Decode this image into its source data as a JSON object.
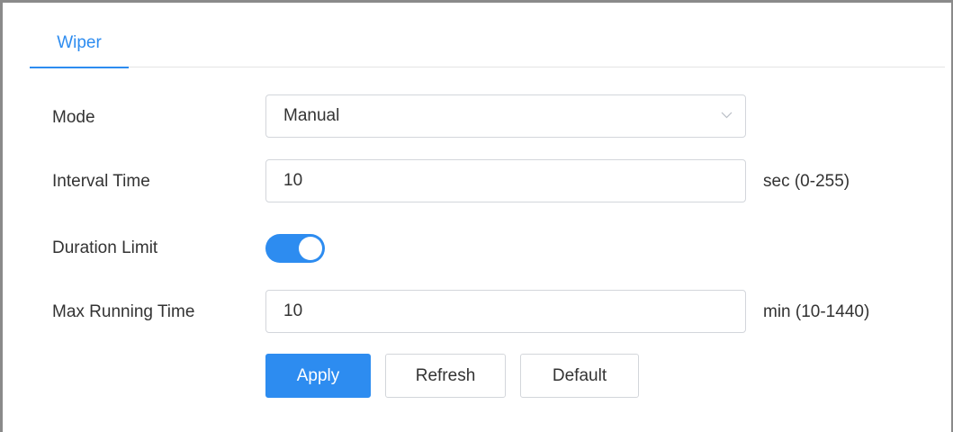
{
  "tabs": [
    {
      "label": "Wiper",
      "active": true
    }
  ],
  "form": {
    "mode": {
      "label": "Mode",
      "value": "Manual"
    },
    "interval_time": {
      "label": "Interval Time",
      "value": "10",
      "unit": "sec (0-255)"
    },
    "duration_limit": {
      "label": "Duration Limit",
      "enabled": true
    },
    "max_running_time": {
      "label": "Max Running Time",
      "value": "10",
      "unit": "min (10-1440)"
    }
  },
  "buttons": {
    "apply": "Apply",
    "refresh": "Refresh",
    "default": "Default"
  },
  "colors": {
    "accent": "#2d8cf0",
    "border": "#d3d6db",
    "text": "#333333"
  },
  "icons": {
    "mode_dropdown": "chevron-down-icon"
  }
}
